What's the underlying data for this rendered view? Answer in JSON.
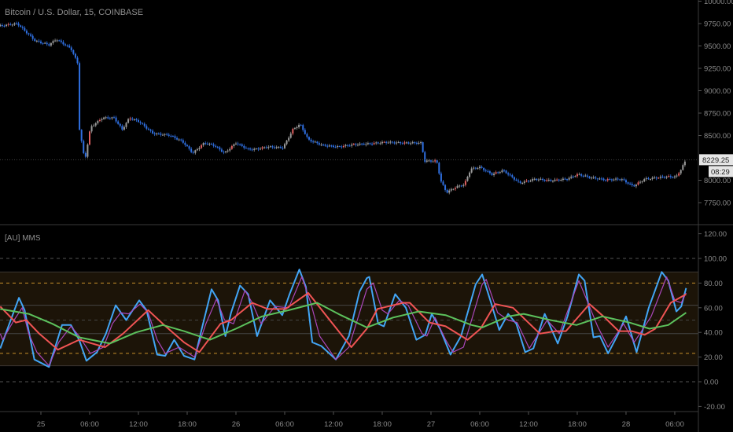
{
  "chart_data": [
    {
      "type": "candlestick",
      "title": "Bitcoin / U.S. Dollar, 15, COINBASE",
      "x_unit": "hours from day 25 00:00",
      "ylim": [
        7600,
        10020
      ],
      "yticks": [
        "10000.00",
        "9750.00",
        "9500.00",
        "9250.00",
        "9000.00",
        "8750.00",
        "8500.00",
        "8000.00",
        "7750.00"
      ],
      "ytick_values": [
        10000,
        9750,
        9500,
        9250,
        9000,
        8750,
        8500,
        8000,
        7750
      ],
      "last_price": "8229.25",
      "last_price_value": 8229.25,
      "countdown": "08:29",
      "colors": {
        "down": "#2f6fe0",
        "up": "#9a9a9a",
        "accent": "#e06060"
      },
      "close": {
        "x": [
          -5.0,
          -2.9,
          -0.7,
          1.0,
          1.9,
          3.7,
          4.5,
          4.6,
          5.4,
          6.1,
          7.6,
          9.0,
          10.0,
          10.9,
          12.1,
          13.8,
          15.8,
          17.4,
          18.7,
          20.1,
          21.3,
          22.6,
          24.0,
          25.5,
          26.4,
          27.9,
          29.8,
          31.0,
          31.9,
          32.9,
          34.7,
          36.6,
          38.5,
          40.5,
          42.4,
          44.3,
          46.8,
          47.2,
          48.7,
          49.2,
          49.9,
          51.1,
          52.1,
          52.9,
          54.0,
          55.5,
          56.9,
          58.9,
          60.8,
          62.7,
          64.7,
          66.1,
          67.6,
          69.5,
          71.4,
          72.9,
          74.3,
          76.8,
          78.2,
          78.8,
          79.4
        ],
        "y": [
          9724,
          9750,
          9557,
          9513,
          9575,
          9470,
          9311,
          8654,
          8215,
          8592,
          8697,
          8697,
          8566,
          8697,
          8654,
          8522,
          8504,
          8434,
          8303,
          8417,
          8390,
          8303,
          8417,
          8346,
          8346,
          8373,
          8364,
          8566,
          8627,
          8452,
          8390,
          8373,
          8399,
          8408,
          8425,
          8417,
          8417,
          8215,
          8215,
          7996,
          7864,
          7925,
          7952,
          8127,
          8145,
          8066,
          8110,
          7969,
          8013,
          7996,
          8013,
          8066,
          8031,
          8004,
          8013,
          7934,
          8013,
          8039,
          8039,
          8127,
          8232
        ]
      }
    },
    {
      "type": "line",
      "title": "[AU] MMS",
      "x_unit": "hours from day 25 00:00",
      "ylim": [
        -25,
        125
      ],
      "yticks": [
        "120.00",
        "100.00",
        "80.00",
        "60.00",
        "40.00",
        "20.00",
        "0.00",
        "-20.00"
      ],
      "ytick_values": [
        120,
        100,
        80,
        60,
        40,
        20,
        0,
        -20
      ],
      "band": {
        "upper": 89,
        "lower": 13,
        "color": "#1c1408"
      },
      "levels": [
        {
          "value": 100,
          "style": "dashed",
          "color": "#555555"
        },
        {
          "value": 80,
          "style": "dashed",
          "color": "#c8902a"
        },
        {
          "value": 62,
          "style": "solid",
          "color": "#444444"
        },
        {
          "value": 50,
          "style": "dashed",
          "color": "#444444"
        },
        {
          "value": 39,
          "style": "solid",
          "color": "#444444"
        },
        {
          "value": 23,
          "style": "dashed",
          "color": "#c8902a"
        },
        {
          "value": 0,
          "style": "dashed",
          "color": "#555555"
        }
      ],
      "series": [
        {
          "name": "fast",
          "color": "#42a5f5",
          "x": [
            -5.0,
            -4.1,
            -2.7,
            -2.0,
            -0.8,
            1.0,
            2.6,
            3.7,
            4.7,
            5.6,
            6.9,
            8.0,
            9.2,
            10.5,
            12.1,
            13.0,
            14.3,
            15.3,
            16.4,
            17.6,
            18.9,
            19.8,
            21.0,
            21.8,
            22.7,
            23.4,
            24.5,
            25.5,
            26.6,
            28.2,
            29.7,
            30.6,
            31.8,
            32.6,
            33.4,
            34.5,
            36.3,
            37.9,
            39.2,
            40.1,
            40.4,
            41.5,
            42.2,
            43.6,
            44.9,
            46.2,
            47.3,
            48.1,
            49.1,
            50.4,
            51.7,
            53.5,
            54.3,
            55.4,
            56.4,
            57.5,
            58.5,
            59.6,
            60.6,
            62.0,
            62.8,
            63.6,
            64.8,
            66.2,
            66.9,
            68.0,
            68.8,
            69.8,
            70.9,
            72.0,
            73.3,
            74.8,
            76.4,
            77.2,
            78.2,
            78.8,
            79.4
          ],
          "y": [
            27,
            43,
            68,
            58,
            18,
            12,
            46,
            46,
            34,
            17,
            24,
            39,
            62,
            50,
            66,
            58,
            22,
            21,
            34,
            21,
            18,
            43,
            75,
            66,
            37,
            56,
            78,
            71,
            37,
            66,
            54,
            71,
            91,
            77,
            32,
            29,
            18,
            37,
            73,
            84,
            85,
            47,
            45,
            71,
            60,
            34,
            38,
            55,
            43,
            22,
            37,
            79,
            87,
            64,
            42,
            55,
            47,
            24,
            27,
            55,
            43,
            31,
            53,
            87,
            82,
            36,
            37,
            23,
            37,
            53,
            24,
            60,
            89,
            82,
            57,
            61,
            76
          ]
        },
        {
          "name": "signal",
          "color": "#ab47bc",
          "x": [
            -5.0,
            -4.7,
            -3.3,
            -2.3,
            -1.5,
            -0.5,
            1.0,
            2.2,
            3.7,
            4.7,
            6.1,
            7.7,
            8.8,
            9.8,
            10.8,
            12.2,
            13.2,
            14.3,
            15.3,
            17.0,
            18.9,
            20.3,
            21.6,
            22.6,
            23.7,
            25.1,
            26.0,
            27.1,
            28.8,
            30.5,
            32.1,
            33.2,
            34.3,
            36.3,
            37.9,
            40.1,
            40.9,
            42.0,
            42.7,
            44.1,
            45.2,
            46.9,
            47.5,
            48.5,
            49.8,
            50.7,
            52.0,
            54.3,
            54.8,
            56.2,
            57.5,
            58.6,
            60.1,
            62.3,
            63.8,
            66.2,
            67.5,
            68.5,
            69.8,
            71.7,
            73.0,
            75.1,
            77.0,
            78.0,
            78.8,
            79.4
          ],
          "y": [
            39,
            34,
            50,
            60,
            39,
            24,
            13,
            32,
            45,
            37,
            23,
            28,
            47,
            56,
            55,
            63,
            56,
            34,
            23,
            28,
            20,
            47,
            67,
            50,
            47,
            74,
            64,
            47,
            61,
            60,
            85,
            64,
            37,
            18,
            28,
            75,
            80,
            58,
            55,
            66,
            62,
            39,
            37,
            52,
            34,
            24,
            28,
            79,
            83,
            56,
            50,
            48,
            27,
            50,
            39,
            82,
            61,
            45,
            28,
            47,
            32,
            53,
            85,
            66,
            64,
            72
          ]
        },
        {
          "name": "slow",
          "color": "#f05454",
          "x": [
            -5.0,
            -3.1,
            -1.8,
            -0.2,
            2.1,
            4.7,
            7.9,
            10.1,
            13.2,
            15.0,
            17.6,
            19.5,
            22.1,
            23.4,
            26.0,
            27.9,
            30.1,
            32.9,
            35.3,
            38.2,
            40.1,
            41.4,
            42.7,
            44.6,
            45.4,
            47.8,
            49.8,
            52.5,
            54.1,
            55.9,
            58.1,
            61.4,
            63.3,
            64.6,
            67.5,
            69.4,
            71.1,
            72.7,
            74.3,
            75.6,
            77.5,
            79.4
          ],
          "y": [
            61,
            48,
            50,
            39,
            26,
            34,
            28,
            39,
            58,
            47,
            32,
            24,
            47,
            50,
            64,
            59,
            59,
            72,
            52,
            28,
            43,
            59,
            61,
            64,
            64,
            48,
            45,
            34,
            43,
            63,
            60,
            39,
            41,
            41,
            63,
            52,
            41,
            41,
            38,
            43,
            64,
            71
          ]
        },
        {
          "name": "trend",
          "color": "#5cc15c",
          "x": [
            -5.0,
            -1.5,
            1.4,
            4.7,
            8.5,
            11.7,
            15.0,
            17.6,
            20.8,
            24.0,
            27.2,
            30.5,
            34.0,
            36.9,
            40.1,
            43.3,
            46.5,
            49.8,
            53.0,
            54.3,
            57.5,
            59.4,
            62.7,
            65.9,
            69.1,
            72.4,
            74.9,
            77.2,
            79.4
          ],
          "y": [
            59,
            55,
            47,
            36,
            31,
            40,
            46,
            41,
            34,
            43,
            53,
            58,
            64,
            54,
            44,
            52,
            57,
            54,
            46,
            44,
            53,
            55,
            50,
            46,
            53,
            48,
            43,
            46,
            56
          ]
        }
      ]
    }
  ],
  "x_axis": {
    "tick_labels": [
      "25",
      "06:00",
      "12:00",
      "18:00",
      "26",
      "06:00",
      "12:00",
      "18:00",
      "27",
      "06:00",
      "12:00",
      "18:00",
      "28",
      "06:00"
    ],
    "tick_values": [
      0,
      6,
      12,
      18,
      24,
      30,
      36,
      42,
      48,
      54,
      60,
      66,
      72,
      78
    ]
  }
}
